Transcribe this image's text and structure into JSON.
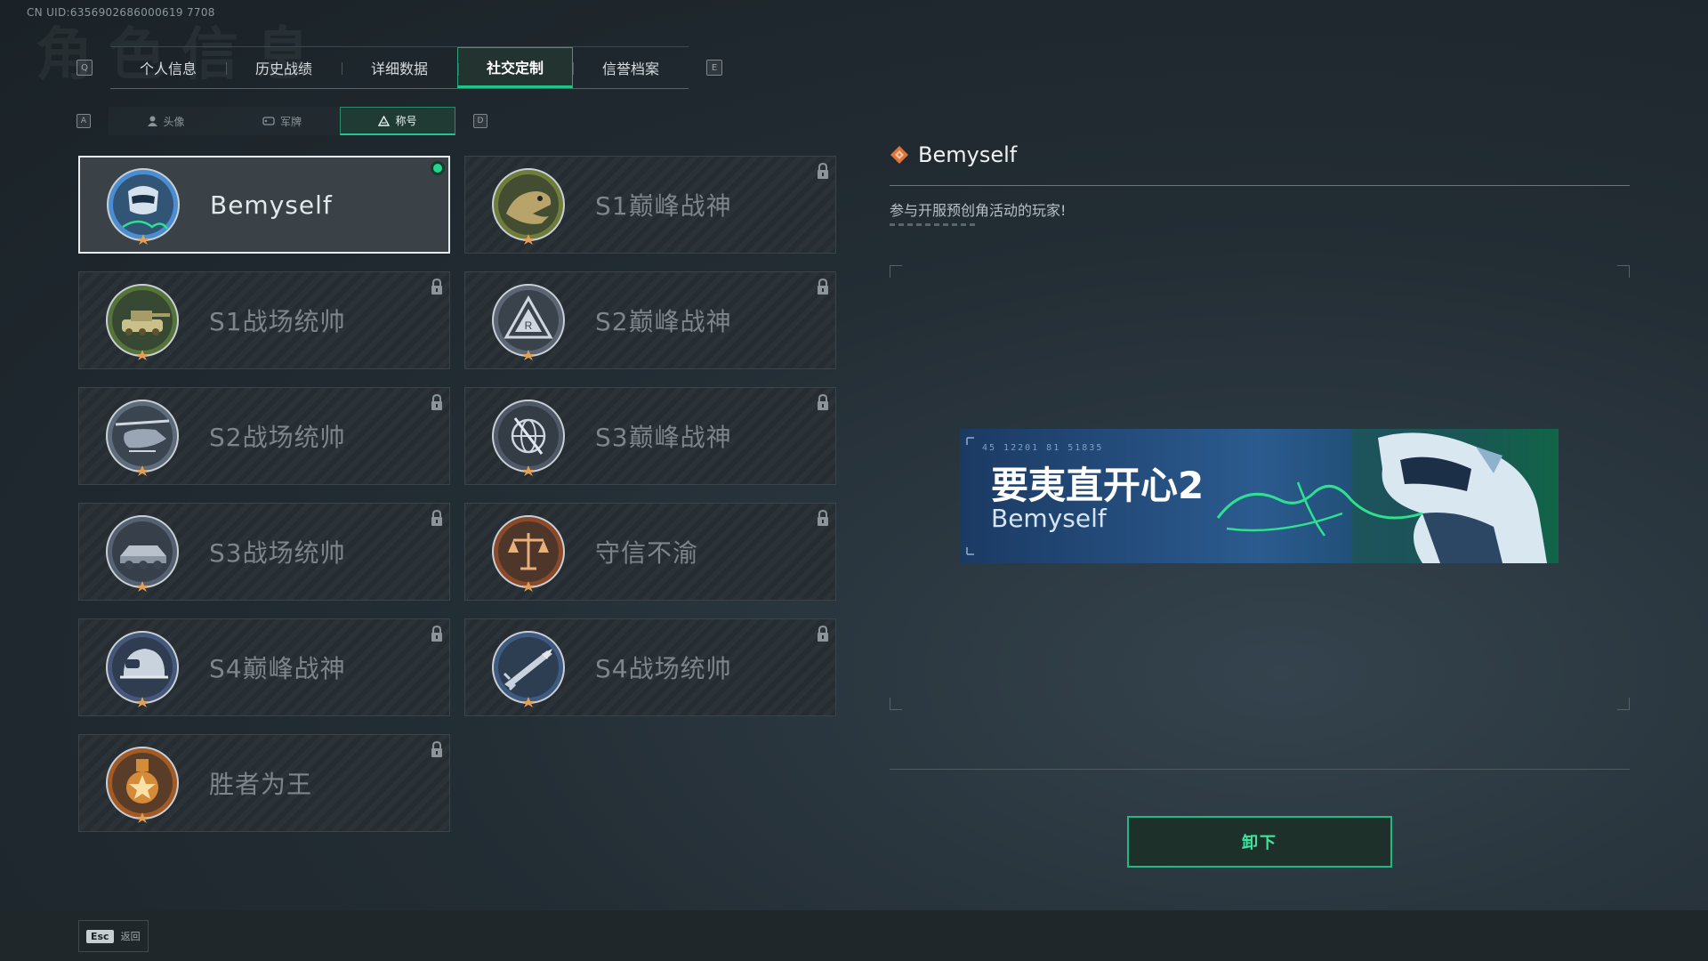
{
  "uid": "CN UID:6356902686000619 7708",
  "watermark": "角色信息",
  "top_tabs": {
    "prev_key": "Q",
    "next_key": "E",
    "items": [
      {
        "label": "个人信息",
        "active": false
      },
      {
        "label": "历史战绩",
        "active": false
      },
      {
        "label": "详细数据",
        "active": false
      },
      {
        "label": "社交定制",
        "active": true
      },
      {
        "label": "信誉档案",
        "active": false
      }
    ]
  },
  "sub_tabs": {
    "prev_key": "A",
    "next_key": "D",
    "items": [
      {
        "label": "头像",
        "icon": "person-icon",
        "active": false
      },
      {
        "label": "军牌",
        "icon": "dogtag-icon",
        "active": false
      },
      {
        "label": "称号",
        "icon": "title-icon",
        "active": true
      }
    ]
  },
  "titles": [
    {
      "label": "Bemyself",
      "selected": true,
      "locked": false,
      "medal": "soldier-badge",
      "color": "#4a8ed1"
    },
    {
      "label": "S1巅峰战神",
      "selected": false,
      "locked": true,
      "medal": "crocodile-badge",
      "color": "#6f7d3a"
    },
    {
      "label": "S1战场统帅",
      "selected": false,
      "locked": true,
      "medal": "tank-badge",
      "color": "#56733a"
    },
    {
      "label": "S2巅峰战神",
      "selected": false,
      "locked": true,
      "medal": "triangle-badge",
      "color": "#5b6574"
    },
    {
      "label": "S2战场统帅",
      "selected": false,
      "locked": true,
      "medal": "helicopter-badge",
      "color": "#5e6b7a"
    },
    {
      "label": "S3巅峰战神",
      "selected": false,
      "locked": true,
      "medal": "globe-badge",
      "color": "#4e5866"
    },
    {
      "label": "S3战场统帅",
      "selected": false,
      "locked": true,
      "medal": "vehicle-badge",
      "color": "#556170"
    },
    {
      "label": "守信不渝",
      "selected": false,
      "locked": true,
      "medal": "scales-badge",
      "color": "#8a4a2a"
    },
    {
      "label": "S4巅峰战神",
      "selected": false,
      "locked": true,
      "medal": "helmet-badge",
      "color": "#45577a"
    },
    {
      "label": "S4战场统帅",
      "selected": false,
      "locked": true,
      "medal": "missile-badge",
      "color": "#3e5a80"
    },
    {
      "label": "胜者为王",
      "selected": false,
      "locked": true,
      "medal": "star-medal-badge",
      "color": "#a35a24"
    }
  ],
  "detail": {
    "title": "Bemyself",
    "description": "参与开服预创角活动的玩家!"
  },
  "banner": {
    "code": "45 12201  81 51835",
    "name": "要夷直开心2",
    "title": "Bemyself"
  },
  "unequip_label": "卸下",
  "footer": {
    "esc_key": "Esc",
    "esc_label": "返回"
  },
  "colors": {
    "accent": "#22c58c",
    "selected_dot": "#22d68f"
  }
}
